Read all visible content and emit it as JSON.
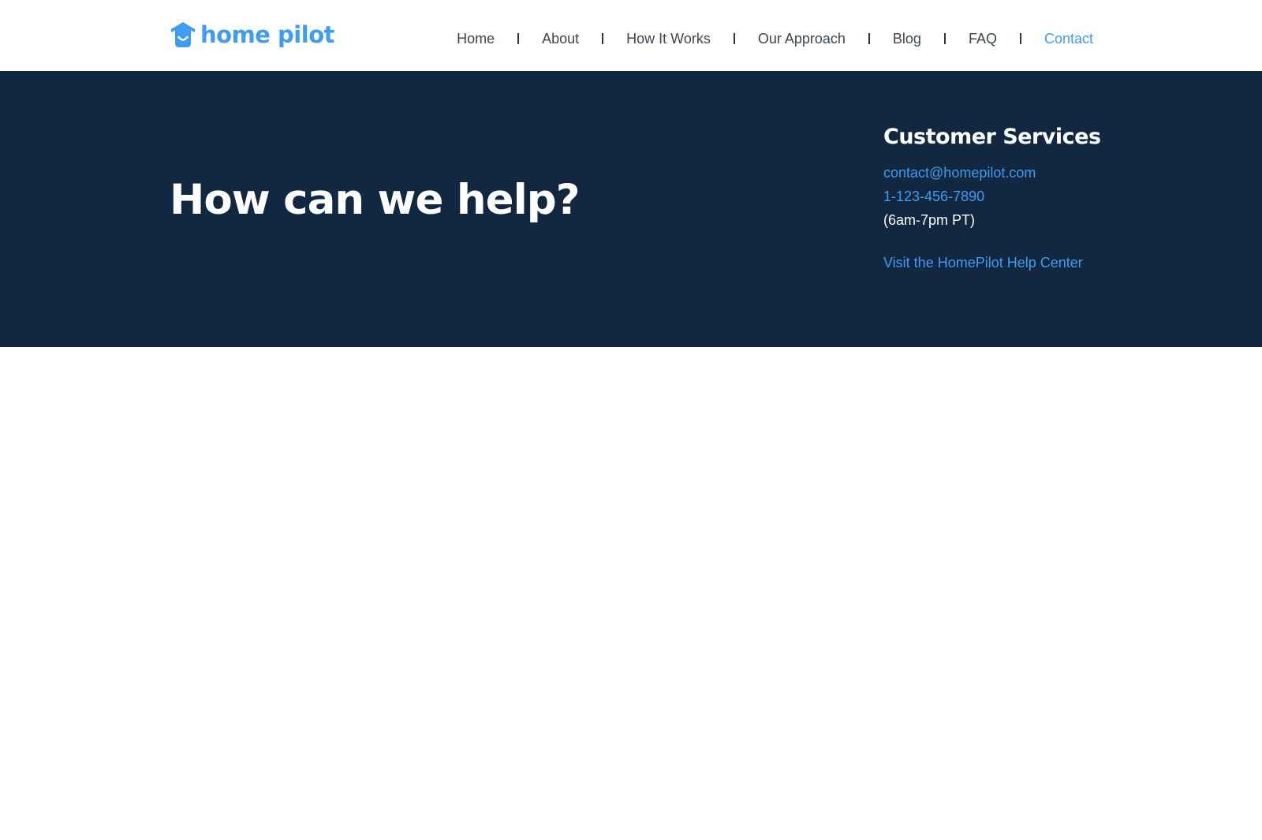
{
  "brand": {
    "name": "home pilot",
    "color": "#3f9cf0",
    "icon": "house-smile-icon"
  },
  "nav": {
    "items": [
      {
        "label": "Home"
      },
      {
        "label": "About"
      },
      {
        "label": "How It Works"
      },
      {
        "label": "Our Approach"
      },
      {
        "label": "Blog"
      },
      {
        "label": "FAQ"
      },
      {
        "label": "Contact",
        "active": true
      }
    ],
    "separator": "|"
  },
  "hero": {
    "title": "How can we help?",
    "background": "#122841"
  },
  "customer_services": {
    "heading": "Customer Services",
    "email": "contact@homepilot.com",
    "phone": "1-123-456-7890",
    "hours": "(6am-7pm PT)",
    "help_center_link": "Visit the HomePilot Help Center"
  }
}
